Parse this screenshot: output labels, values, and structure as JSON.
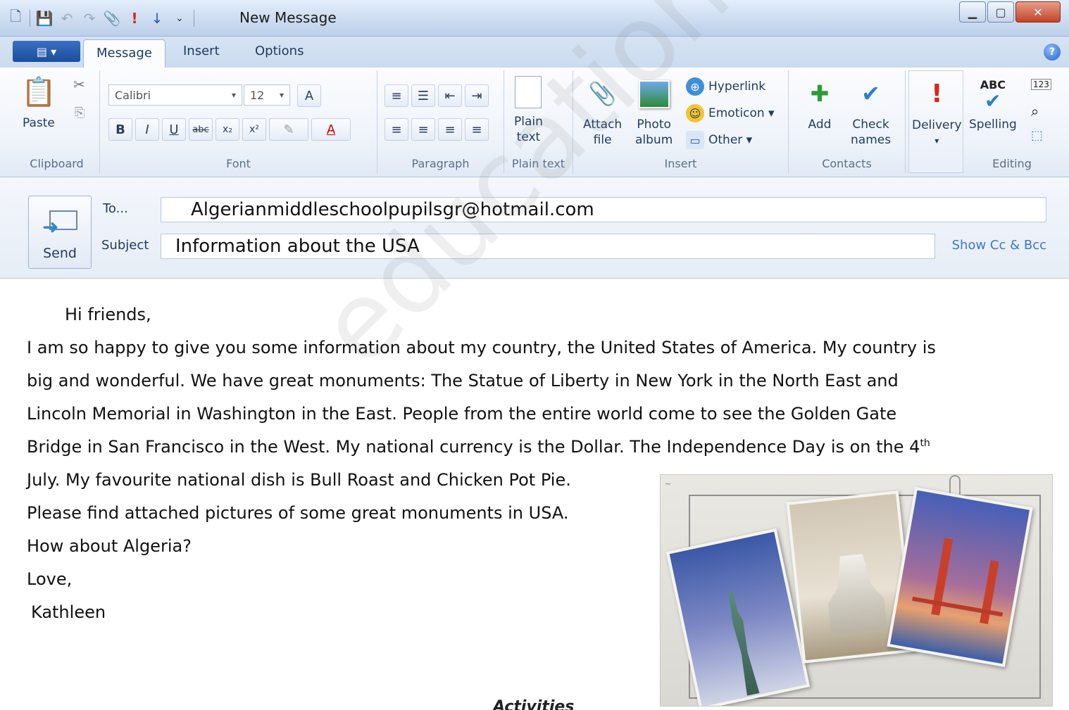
{
  "window": {
    "title": "New Message",
    "controls": {
      "minimize": "▁",
      "maximize": "▢",
      "close": "✕"
    }
  },
  "tabs": {
    "file_menu": "▤ ▾",
    "items": [
      {
        "label": "Message"
      },
      {
        "label": "Insert"
      },
      {
        "label": "Options"
      }
    ],
    "help": "?"
  },
  "ribbon": {
    "clipboard": {
      "label": "Clipboard",
      "paste": "Paste"
    },
    "font": {
      "label": "Font",
      "family": "Calibri",
      "size": "12",
      "bold": "B",
      "italic": "I",
      "underline": "U",
      "strike": "abc",
      "subscript": "x₂",
      "superscript": "x²",
      "highlight": "✎",
      "color": "A"
    },
    "paragraph": {
      "label": "Paragraph"
    },
    "plain_text": {
      "label": "Plain text",
      "button": "Plain\ntext"
    },
    "insert": {
      "label": "Insert",
      "attach": "Attach\nfile",
      "photo": "Photo\nalbum",
      "hyperlink": "Hyperlink",
      "emoticon": "Emoticon ▾",
      "other": "Other ▾"
    },
    "contacts": {
      "label": "Contacts",
      "add": "Add",
      "check": "Check\nnames"
    },
    "delivery": {
      "label": "Delivery",
      "arrow": "▾"
    },
    "editing": {
      "label": "Editing",
      "spelling": "Spelling",
      "abc": "ABC"
    }
  },
  "header": {
    "send": "Send",
    "to_label": "To...",
    "to_value": "Algerianmiddleschoolpupilsgr@hotmail.com",
    "subject_label": "Subject",
    "subject_value": "Information about the USA",
    "show_cc": "Show Cc & Bcc"
  },
  "body": {
    "greeting": "Hi friends,",
    "line1": "I am so happy to give you some information about my country, the United States of America. My country is",
    "line2": "big and wonderful. We have great monuments: The Statue of Liberty in New York in the North East and",
    "line3": "Lincoln Memorial in Washington in the East. People from the entire world come to see the Golden Gate",
    "line4a": "Bridge in San Francisco in the West. My national currency is the Dollar. The Independence Day is on the 4",
    "line4sup": "th",
    "line5": "July. My favourite national dish is Bull Roast and Chicken Pot Pie.",
    "line6": "Please find attached pictures of some great monuments in USA.",
    "line7": "How about Algeria?",
    "line8": "Love,",
    "signature": "Kathleen"
  },
  "footer": {
    "activities": "Activities"
  },
  "watermark": "education.com/exams"
}
